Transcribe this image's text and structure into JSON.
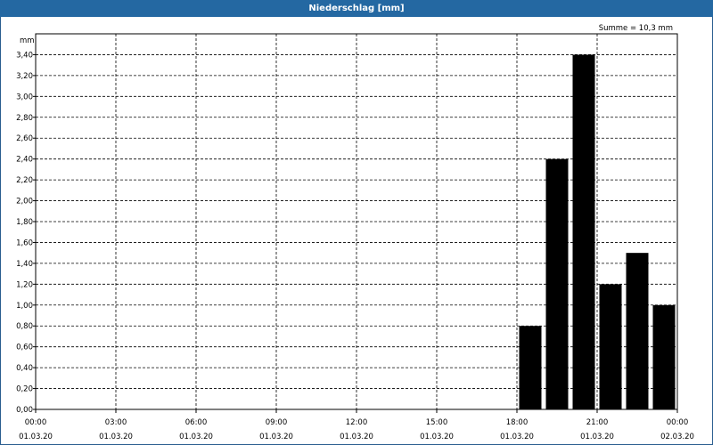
{
  "window": {
    "title": "Niederschlag [mm]"
  },
  "summary": {
    "text": "Summe = 10,3 mm"
  },
  "chart_data": {
    "type": "bar",
    "title": "Niederschlag [mm]",
    "ylabel": "mm",
    "xlabel": "",
    "ylim": [
      0,
      3.6
    ],
    "ytick_step": 0.2,
    "y_tick_labels": [
      "0,00",
      "0,20",
      "0,40",
      "0,60",
      "0,80",
      "1,00",
      "1,20",
      "1,40",
      "1,60",
      "1,80",
      "2,00",
      "2,20",
      "2,40",
      "2,60",
      "2,80",
      "3,00",
      "3,20",
      "3,40"
    ],
    "x_range_hours": [
      0,
      24
    ],
    "x_ticks": [
      {
        "time": "00:00",
        "date": "01.03.20"
      },
      {
        "time": "03:00",
        "date": "01.03.20"
      },
      {
        "time": "06:00",
        "date": "01.03.20"
      },
      {
        "time": "09:00",
        "date": "01.03.20"
      },
      {
        "time": "12:00",
        "date": "01.03.20"
      },
      {
        "time": "15:00",
        "date": "01.03.20"
      },
      {
        "time": "18:00",
        "date": "01.03.20"
      },
      {
        "time": "21:00",
        "date": "01.03.20"
      },
      {
        "time": "00:00",
        "date": "02.03.20"
      }
    ],
    "bar_hours": [
      18,
      19,
      20,
      21,
      22,
      23
    ],
    "values": [
      0.8,
      2.4,
      3.4,
      1.2,
      1.5,
      1.0
    ],
    "bar_color": "#000000",
    "grid": true,
    "total": "10,3 mm"
  }
}
